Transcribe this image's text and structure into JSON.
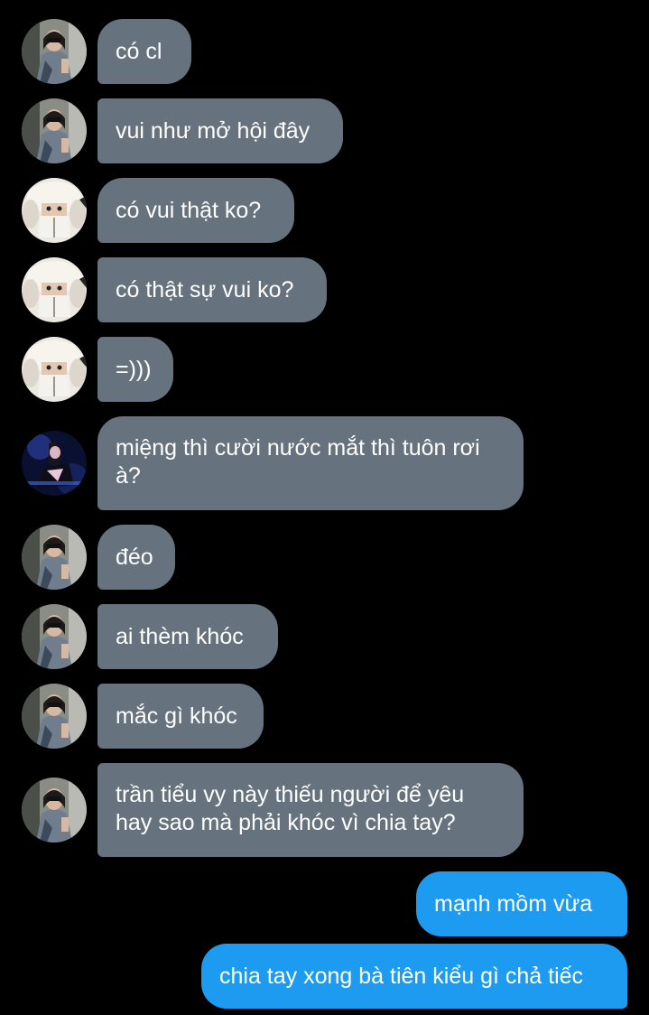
{
  "conversation": {
    "messages": [
      {
        "id": "m1",
        "direction": "incoming",
        "avatar": "woman-sunglasses-avatar",
        "lines": [
          "có cl"
        ]
      },
      {
        "id": "m2",
        "direction": "incoming",
        "avatar": "woman-sunglasses-avatar",
        "lines": [
          "vui như mở hội đây"
        ]
      },
      {
        "id": "m3",
        "direction": "incoming",
        "avatar": "white-hat-avatar",
        "lines": [
          "có vui thật ko?"
        ]
      },
      {
        "id": "m4",
        "direction": "incoming",
        "avatar": "white-hat-avatar",
        "lines": [
          "có thật sự vui ko?"
        ]
      },
      {
        "id": "m5",
        "direction": "incoming",
        "avatar": "white-hat-avatar",
        "lines": [
          "=)))"
        ]
      },
      {
        "id": "m6",
        "direction": "incoming",
        "avatar": "dark-blue-photo-avatar",
        "lines": [
          "miệng thì cười nước mắt thì tuôn rơi",
          "à?"
        ]
      },
      {
        "id": "m7",
        "direction": "incoming",
        "avatar": "woman-sunglasses-avatar",
        "lines": [
          "đéo"
        ]
      },
      {
        "id": "m8",
        "direction": "incoming",
        "avatar": "woman-sunglasses-avatar",
        "lines": [
          "ai thèm khóc"
        ]
      },
      {
        "id": "m9",
        "direction": "incoming",
        "avatar": "woman-sunglasses-avatar",
        "lines": [
          "mắc gì khóc"
        ]
      },
      {
        "id": "m10",
        "direction": "incoming",
        "avatar": "woman-sunglasses-avatar",
        "lines": [
          "trần tiểu vy này thiếu người để yêu",
          "hay sao mà phải khóc vì chia tay?"
        ]
      },
      {
        "id": "m11",
        "direction": "outgoing",
        "lines": [
          "mạnh mồm vừa"
        ]
      },
      {
        "id": "m12",
        "direction": "outgoing",
        "lines": [
          "chia tay xong bà tiên kiểu gì chả tiếc"
        ]
      }
    ]
  },
  "colors": {
    "background": "#000000",
    "incoming_bubble": "#66737f",
    "outgoing_bubble": "#1d9bf0",
    "text": "#ffffff"
  }
}
